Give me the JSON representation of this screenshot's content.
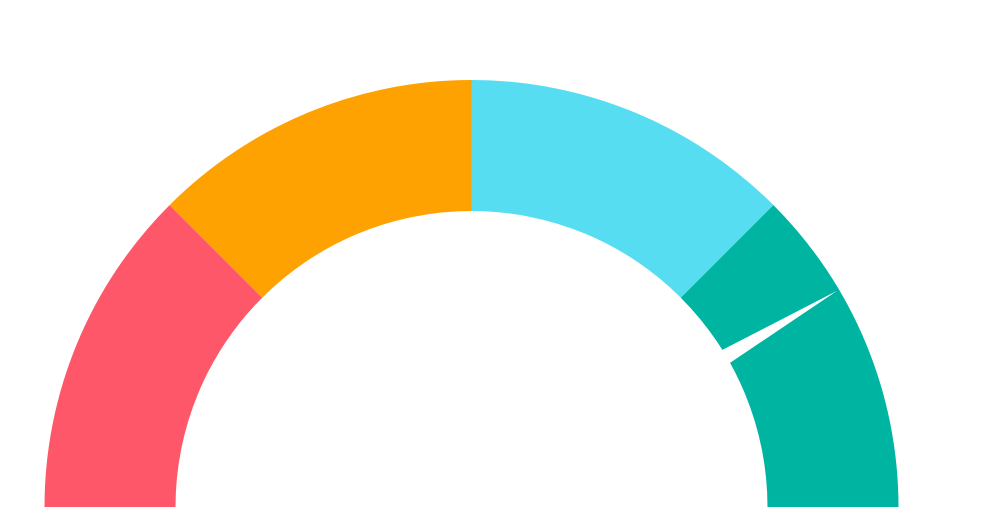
{
  "chart_data": {
    "type": "gauge",
    "range": [
      0,
      100
    ],
    "bands": [
      {
        "from": 0,
        "to": 25,
        "color": "#fe5769"
      },
      {
        "from": 25,
        "to": 50,
        "color": "#fea201"
      },
      {
        "from": 50,
        "to": 75,
        "color": "#57ddf2"
      },
      {
        "from": 75,
        "to": 100,
        "color": "#00b4a2"
      }
    ],
    "needle": {
      "value": 83,
      "color": "#ffffff"
    },
    "title": "",
    "value_label": ""
  }
}
